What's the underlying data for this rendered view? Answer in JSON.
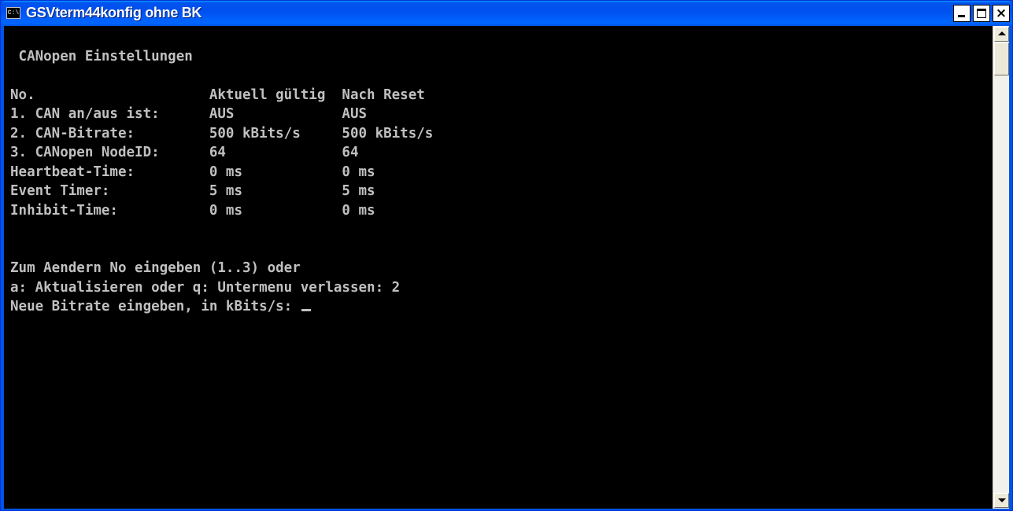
{
  "window": {
    "title": "GSVterm44konfig ohne BK",
    "icon": "console-icon",
    "icon_glyph": "C:\\",
    "buttons": {
      "minimize": "minimize-icon",
      "maximize": "maximize-icon",
      "close": "close-icon",
      "close_glyph": "×"
    }
  },
  "console": {
    "lines": [
      "",
      " CANopen Einstellungen",
      "",
      "No.                     Aktuell gültig  Nach Reset",
      "1. CAN an/aus ist:      AUS             AUS",
      "2. CAN-Bitrate:         500 kBits/s     500 kBits/s",
      "3. CANopen NodeID:      64              64",
      "Heartbeat-Time:         0 ms            0 ms",
      "Event Timer:            5 ms            5 ms",
      "Inhibit-Time:           0 ms            0 ms",
      "",
      "",
      "Zum Aendern No eingeben (1..3) oder",
      "a: Aktualisieren oder q: Untermenu verlassen: 2",
      "Neue Bitrate eingeben, in kBits/s: "
    ],
    "colors": {
      "background": "#000000",
      "foreground": "#c0c0c0"
    }
  },
  "scrollbar": {
    "position": 0
  }
}
